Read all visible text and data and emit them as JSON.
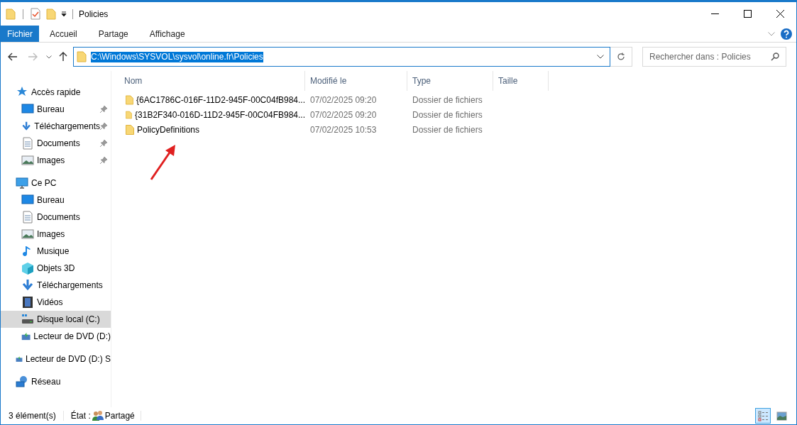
{
  "window": {
    "title": "Policies"
  },
  "ribbon_tabs": [
    {
      "label": "Fichier",
      "selected": true
    },
    {
      "label": "Accueil",
      "selected": false
    },
    {
      "label": "Partage",
      "selected": false
    },
    {
      "label": "Affichage",
      "selected": false
    }
  ],
  "address": {
    "value": "C:\\Windows\\SYSVOL\\sysvol\\online.fr\\Policies"
  },
  "search": {
    "placeholder": "Rechercher dans : Policies"
  },
  "sidebar": {
    "items": [
      {
        "label": "Accès rapide",
        "kind": "star",
        "selected": false,
        "children": [
          {
            "label": "Bureau",
            "kind": "desktop",
            "pinned": true,
            "selected": false
          },
          {
            "label": "Téléchargements",
            "kind": "download",
            "pinned": true,
            "selected": false
          },
          {
            "label": "Documents",
            "kind": "document",
            "pinned": true,
            "selected": false
          },
          {
            "label": "Images",
            "kind": "images",
            "pinned": true,
            "selected": false
          }
        ]
      },
      {
        "label": "Ce PC",
        "kind": "pc",
        "selected": false,
        "children": [
          {
            "label": "Bureau",
            "kind": "desktop",
            "pinned": false,
            "selected": false
          },
          {
            "label": "Documents",
            "kind": "document",
            "pinned": false,
            "selected": false
          },
          {
            "label": "Images",
            "kind": "images",
            "pinned": false,
            "selected": false
          },
          {
            "label": "Musique",
            "kind": "music",
            "pinned": false,
            "selected": false
          },
          {
            "label": "Objets 3D",
            "kind": "cube",
            "pinned": false,
            "selected": false
          },
          {
            "label": "Téléchargements",
            "kind": "download",
            "pinned": false,
            "selected": false
          },
          {
            "label": "Vidéos",
            "kind": "video",
            "pinned": false,
            "selected": false
          },
          {
            "label": "Disque local (C:)",
            "kind": "drive",
            "pinned": false,
            "selected": true
          },
          {
            "label": "Lecteur de DVD (D:)",
            "kind": "dvd",
            "pinned": false,
            "selected": false
          }
        ]
      },
      {
        "label": "Lecteur de DVD (D:) S",
        "kind": "dvd",
        "selected": false
      },
      {
        "label": "Réseau",
        "kind": "network",
        "selected": false
      }
    ]
  },
  "table": {
    "columns": [
      "Nom",
      "Modifié le",
      "Type",
      "Taille"
    ],
    "rows": [
      {
        "name": "{6AC1786C-016F-11D2-945F-00C04fB984...",
        "modified": "07/02/2025 09:20",
        "type": "Dossier de fichiers"
      },
      {
        "name": "{31B2F340-016D-11D2-945F-00C04FB984...",
        "modified": "07/02/2025 09:20",
        "type": "Dossier de fichiers"
      },
      {
        "name": "PolicyDefinitions",
        "modified": "07/02/2025 10:53",
        "type": "Dossier de fichiers"
      }
    ]
  },
  "status_bar": {
    "count": "3 élément(s)",
    "state_label": "État :",
    "state": "Partagé"
  },
  "view_buttons": [
    {
      "kind": "details",
      "selected": true
    },
    {
      "kind": "thumbnails",
      "selected": false
    }
  ]
}
